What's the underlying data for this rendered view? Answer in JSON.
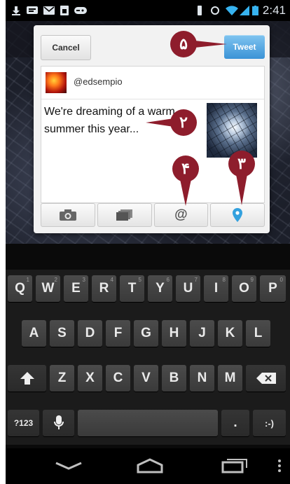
{
  "status_bar": {
    "time": "2:41",
    "icons": [
      "download-icon",
      "sms-icon",
      "email-icon",
      "sim-icon",
      "gamepad-icon",
      "vibrate-icon",
      "sync-icon",
      "wifi-icon",
      "signal-icon",
      "battery-icon"
    ]
  },
  "dialog": {
    "cancel_label": "Cancel",
    "tweet_label": "Tweet",
    "username": "@edsempio",
    "tweet_text": "We're dreaming of a warm summer this year...",
    "toolbar": [
      "camera-icon",
      "gallery-icon",
      "mention-icon",
      "location-pin-icon"
    ],
    "mention_label": "@"
  },
  "callouts": {
    "tweet": "۵",
    "text": "۲",
    "mention": "۴",
    "location": "۳"
  },
  "keyboard": {
    "row1": [
      {
        "label": "Q",
        "hint": "1"
      },
      {
        "label": "W",
        "hint": "2"
      },
      {
        "label": "E",
        "hint": "3"
      },
      {
        "label": "R",
        "hint": "4"
      },
      {
        "label": "T",
        "hint": "5"
      },
      {
        "label": "Y",
        "hint": "6"
      },
      {
        "label": "U",
        "hint": "7"
      },
      {
        "label": "I",
        "hint": "8"
      },
      {
        "label": "O",
        "hint": "9"
      },
      {
        "label": "P",
        "hint": "0"
      }
    ],
    "row2": [
      "A",
      "S",
      "D",
      "F",
      "G",
      "H",
      "J",
      "K",
      "L"
    ],
    "row3": [
      "Z",
      "X",
      "C",
      "V",
      "B",
      "N",
      "M"
    ],
    "numbers_key": "?123",
    "period_key": ".",
    "smiley_key": ":-)"
  },
  "colors": {
    "accent": "#3b93d6",
    "callout": "#8e1d2c",
    "location_blue": "#33a1de"
  }
}
